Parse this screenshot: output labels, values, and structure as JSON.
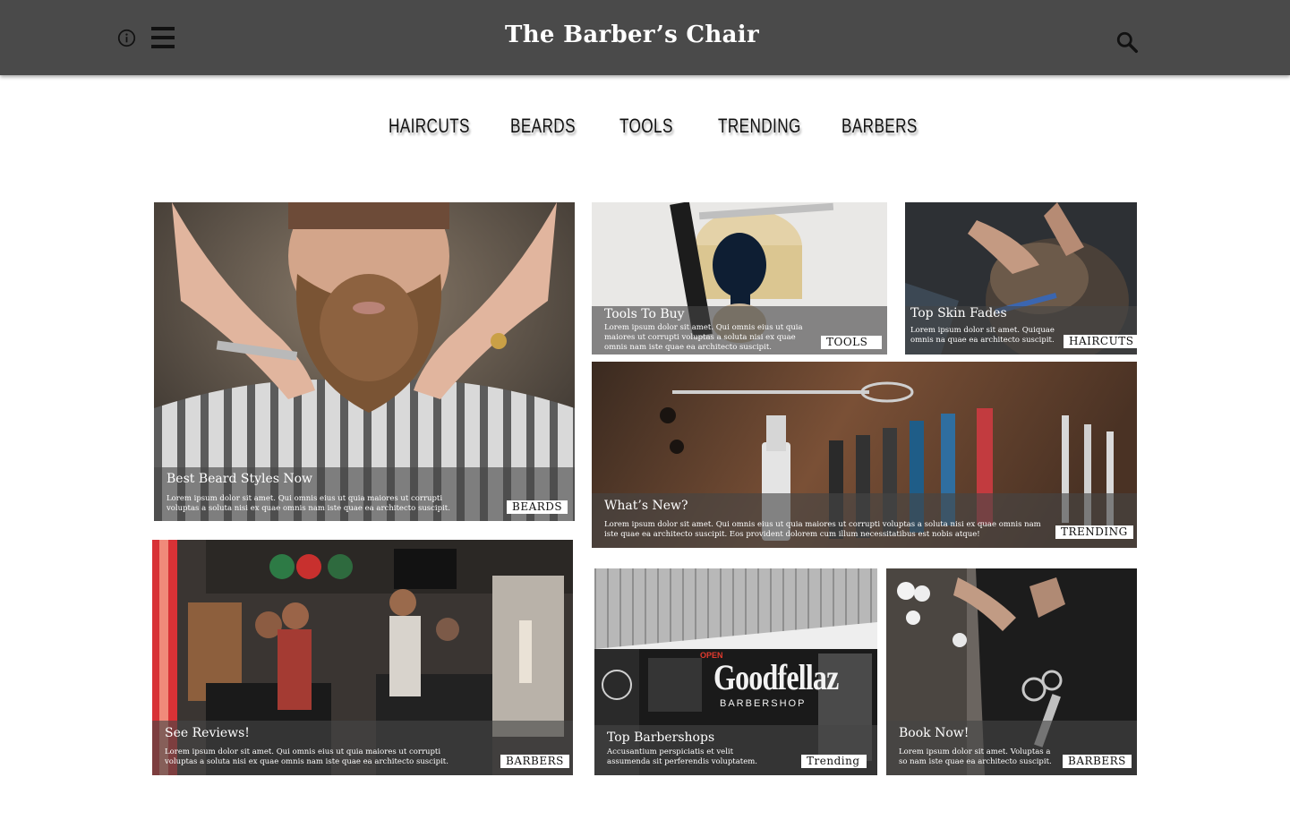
{
  "header": {
    "title": "The Barber’s Chair",
    "icons": [
      "info-icon",
      "menu-icon",
      "search-icon"
    ],
    "background": "#4a4a4a"
  },
  "nav": {
    "items": [
      "HAIRCUTS",
      "BEARDS",
      "TOOLS",
      "TRENDING",
      "BARBERS"
    ]
  },
  "cards": {
    "beard": {
      "title": "Best Beard Styles Now",
      "text": "Lorem ipsum dolor sit amet. Qui omnis eius ut quia maiores ut corrupti voluptas a soluta nisi ex quae omnis nam iste quae ea architecto suscipit.",
      "tag": "BEARDS"
    },
    "tools": {
      "title": "Tools To Buy",
      "text": "Lorem ipsum dolor sit amet. Qui omnis eius ut quia maiores ut corrupti voluptas a soluta nisi ex quae omnis nam iste quae ea architecto suscipit.",
      "tag": "TOOLS"
    },
    "fades": {
      "title": "Top Skin Fades",
      "text": "Lorem ipsum dolor sit amet. Quiquae omnis na quae ea architecto suscipit.",
      "tag": "HAIRCUTS"
    },
    "new": {
      "title": "What’s New?",
      "text": "Lorem ipsum dolor sit amet. Qui omnis eius ut quia maiores ut corrupti voluptas a soluta nisi ex quae omnis nam iste quae ea architecto suscipit. Eos provident dolorem cum illum necessitatibus est nobis atque!",
      "tag": "TRENDING"
    },
    "reviews": {
      "title": "See Reviews!",
      "text": "Lorem ipsum dolor sit amet. Qui omnis eius ut quia maiores ut corrupti voluptas a soluta nisi ex quae omnis nam iste quae ea architecto suscipit.",
      "tag": "BARBERS"
    },
    "shops": {
      "title": "Top Barbershops",
      "text": "Accusantium perspiciatis et velit assumenda sit perferendis voluptatem.",
      "tag": "Trending",
      "sign_text": "Goodfellaz",
      "sign_sub": "BARBERSHOP",
      "sign_small": "OPEN"
    },
    "book": {
      "title": "Book Now!",
      "text": "Lorem ipsum dolor sit amet. Voluptas a so nam iste quae ea architecto suscipit.",
      "tag": "BARBERS"
    }
  }
}
